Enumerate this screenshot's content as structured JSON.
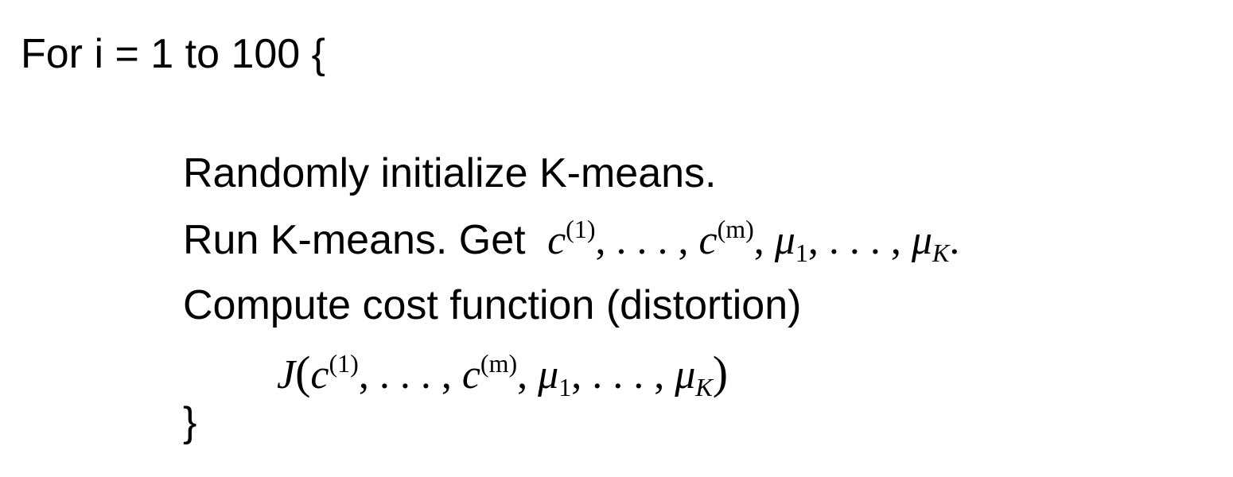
{
  "slide": {
    "for_line": "For i = 1 to 100 {",
    "init_line": "Randomly initialize K-means.",
    "run_line_text": "Run K-means. Get",
    "run_math": {
      "c": "c",
      "sup1": "(1)",
      "sep1": ", . . . , ",
      "supm": "(m)",
      "mu": "μ",
      "sub1": "1",
      "sep2": ", . . . , ",
      "subK": "K",
      "end": "."
    },
    "cost_line": "Compute cost function (distortion)",
    "j_math": {
      "J": "J",
      "open": "(",
      "c": "c",
      "sup1": "(1)",
      "sep1": ", . . . , ",
      "supm": "(m)",
      "mu": "μ",
      "sub1": "1",
      "sep2": ", . . . , ",
      "subK": "K",
      "close": ")"
    },
    "close_brace": "}"
  }
}
